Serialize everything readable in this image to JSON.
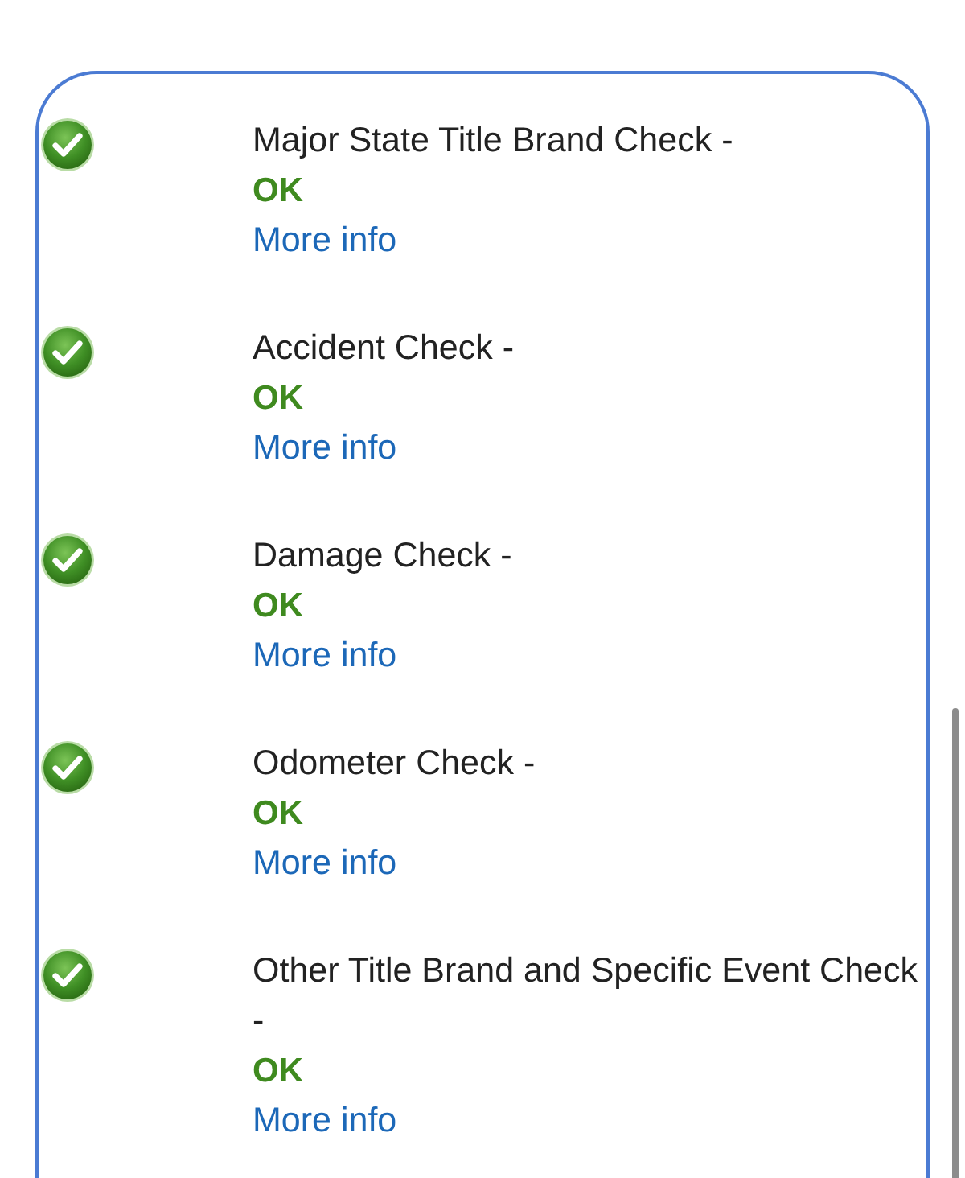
{
  "checks": [
    {
      "title": "Major State Title Brand Check -",
      "status": "OK",
      "link": "More info"
    },
    {
      "title": "Accident Check -",
      "status": "OK",
      "link": "More info"
    },
    {
      "title": "Damage Check -",
      "status": "OK",
      "link": "More info"
    },
    {
      "title": "Odometer Check -",
      "status": "OK",
      "link": "More info"
    },
    {
      "title": "Other Title Brand and Specific Event Check -",
      "status": "OK",
      "link": "More info"
    }
  ]
}
